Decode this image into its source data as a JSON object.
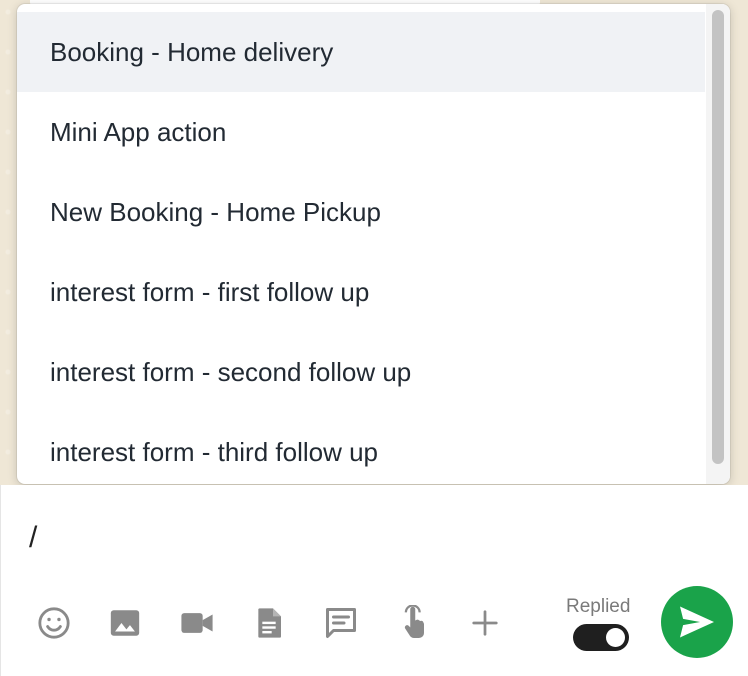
{
  "quick_replies": {
    "items": [
      {
        "label": "Booking - Home delivery",
        "active": true
      },
      {
        "label": "Mini App action",
        "active": false
      },
      {
        "label": "New Booking - Home Pickup",
        "active": false
      },
      {
        "label": "interest form - first follow up",
        "active": false
      },
      {
        "label": "interest form - second follow up",
        "active": false
      },
      {
        "label": "interest form - third follow up",
        "active": false
      }
    ]
  },
  "composer": {
    "input_value": "/",
    "replied_label": "Replied",
    "replied_on": true
  },
  "toolbar": {
    "icons": [
      "emoji-icon",
      "image-icon",
      "video-icon",
      "document-icon",
      "template-icon",
      "interactive-icon",
      "plus-icon",
      "send-icon"
    ]
  },
  "colors": {
    "send_button": "#1aa34a",
    "toggle_on": "#1f1f1f",
    "active_item_bg": "#f0f2f5",
    "icon_gray": "#8a8a8a"
  }
}
